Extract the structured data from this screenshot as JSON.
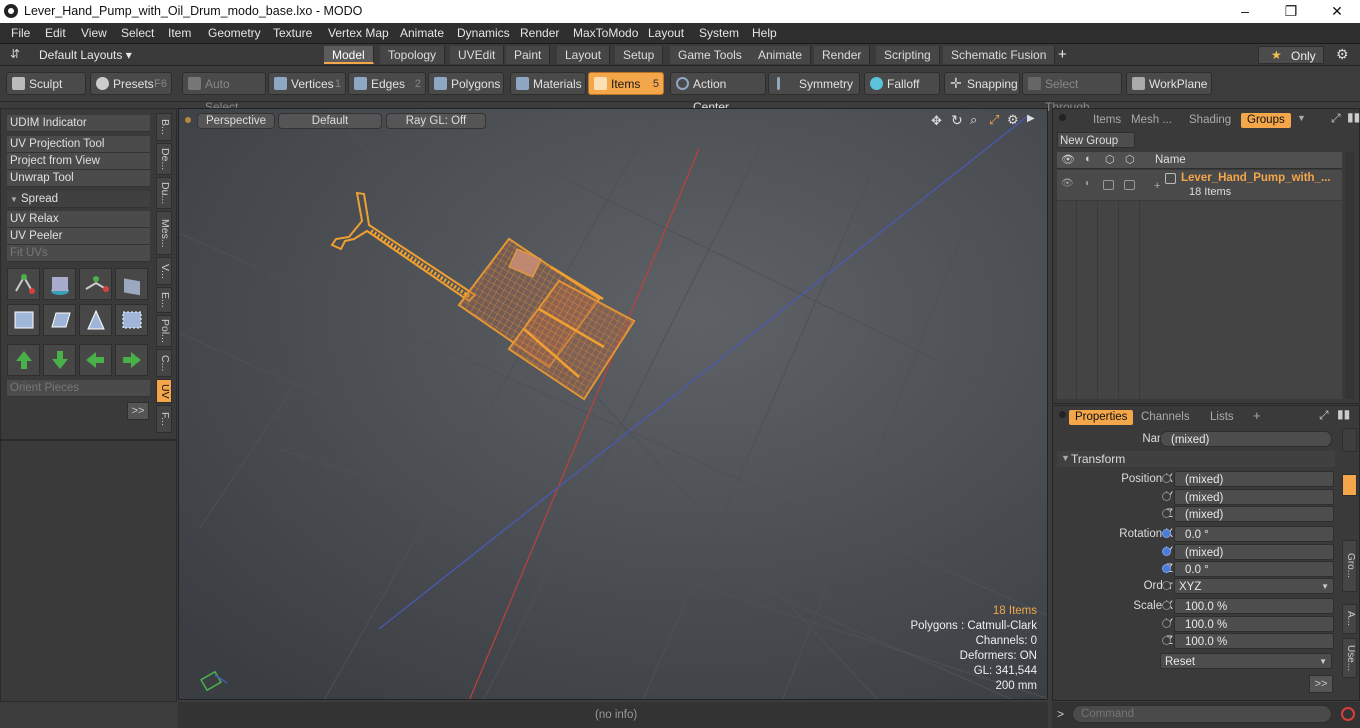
{
  "window": {
    "title": "Lever_Hand_Pump_with_Oil_Drum_modo_base.lxo - MODO"
  },
  "menu": [
    "File",
    "Edit",
    "View",
    "Select",
    "Item",
    "Geometry",
    "Texture",
    "Vertex Map",
    "Animate",
    "Dynamics",
    "Render",
    "MaxToModo",
    "Layout",
    "System",
    "Help"
  ],
  "layout": {
    "default_label": "Default Layouts ▾",
    "only_label": "Only",
    "tabs": [
      "Model",
      "Topology",
      "UVEdit",
      "Paint",
      "Layout",
      "Setup",
      "Game Tools",
      "Animate",
      "Render",
      "Scripting",
      "Schematic Fusion",
      "+"
    ]
  },
  "toolbar": {
    "sculpt": "Sculpt",
    "presets": "Presets",
    "presets_key": "F6",
    "auto_select": "Auto Select",
    "vertices": "Vertices",
    "vertices_n": "1",
    "edges": "Edges",
    "edges_n": "2",
    "polygons": "Polygons",
    "materials": "Materials",
    "items": "Items",
    "items_n": "5",
    "action_center": "Action Center",
    "symmetry": "Symmetry",
    "falloff": "Falloff",
    "snapping": "Snapping",
    "select_through": "Select Through",
    "workplane": "WorkPlane"
  },
  "left": {
    "buttons": [
      "UDIM Indicator",
      "UV Projection Tool",
      "Project from View",
      "Unwrap Tool"
    ],
    "spread": "Spread",
    "buttons2": [
      "UV Relax",
      "UV Peeler",
      "Fit UVs"
    ],
    "orient": "Orient Pieces",
    "more": ">>",
    "vtabs": [
      "B...",
      "De...",
      "Du...",
      "Mes...",
      "V...",
      "E...",
      "Pol...",
      "C...",
      "UV",
      "F..."
    ]
  },
  "viewport": {
    "perspective": "Perspective",
    "default": "Default",
    "raygl": "Ray GL: Off",
    "stats": [
      "18 Items",
      "Polygons : Catmull-Clark",
      "Channels: 0",
      "Deformers: ON",
      "GL: 341,544",
      "200 mm"
    ]
  },
  "status": {
    "info": "(no info)"
  },
  "items_panel": {
    "tabs": [
      "Items",
      "Mesh ...",
      "Shading",
      "Groups"
    ],
    "new_group": "New Group",
    "col_name": "Name",
    "group_name": "Lever_Hand_Pump_with_...",
    "group_count": "18 Items"
  },
  "props": {
    "tabs": [
      "Properties",
      "Channels",
      "Lists",
      "+"
    ],
    "name_label": "Name",
    "name_value": "(mixed)",
    "transform": "Transform",
    "rows": [
      {
        "label": "Position X",
        "value": "(mixed)"
      },
      {
        "label": "Y",
        "value": "(mixed)"
      },
      {
        "label": "Z",
        "value": "(mixed)"
      },
      {
        "label": "Rotation X",
        "value": "0.0 °"
      },
      {
        "label": "Y",
        "value": "(mixed)"
      },
      {
        "label": "Z",
        "value": "0.0 °"
      },
      {
        "label": "Order",
        "value": "XYZ"
      },
      {
        "label": "Scale X",
        "value": "100.0 %"
      },
      {
        "label": "Y",
        "value": "100.0 %"
      },
      {
        "label": "Z",
        "value": "100.0 %"
      }
    ],
    "reset": "Reset",
    "more": ">>",
    "vtabs": [
      "Gro...",
      "A...",
      "Use..."
    ]
  },
  "command": {
    "placeholder": "Command",
    "prompt": ">"
  },
  "colors": {
    "accent": "#f3a64a",
    "selected_wire": "#f0a030"
  }
}
